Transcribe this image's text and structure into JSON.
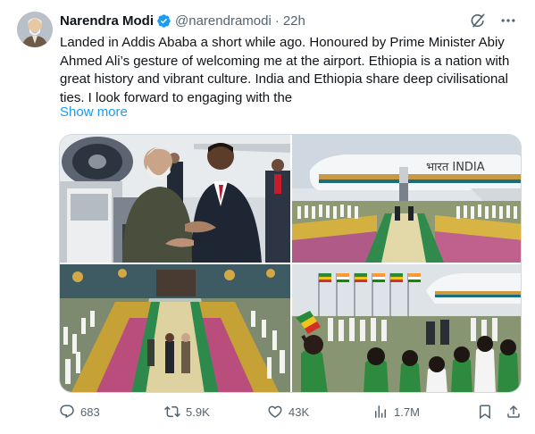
{
  "author": {
    "name": "Narendra Modi",
    "handle": "@narendramodi",
    "separator": "·",
    "time": "22h",
    "verified": true,
    "avatar_icon": "avatar-photo"
  },
  "post": {
    "text": "Landed in Addis Ababa a short while ago. Honoured by Prime Minister Abiy Ahmed Ali’s gesture of welcoming me at the airport. Ethiopia is a nation with great history and vibrant culture. India and Ethiopia share deep civilisational ties. I look forward to engaging with the",
    "show_more": "Show more"
  },
  "media": {
    "photos": [
      {
        "icon": "photo-leaders-embrace"
      },
      {
        "icon": "photo-aircraft-welcome"
      },
      {
        "icon": "photo-carpet-walk"
      },
      {
        "icon": "photo-crowd-flags"
      }
    ],
    "aircraft_livery": "भारत  INDIA"
  },
  "metrics": {
    "replies": "683",
    "reposts": "5.9K",
    "likes": "43K",
    "views": "1.7M"
  },
  "colors": {
    "text": "#0f1419",
    "secondary": "#536471",
    "link": "#1d9bf0",
    "verified": "#1d9bf0",
    "border": "#cfd9de"
  }
}
